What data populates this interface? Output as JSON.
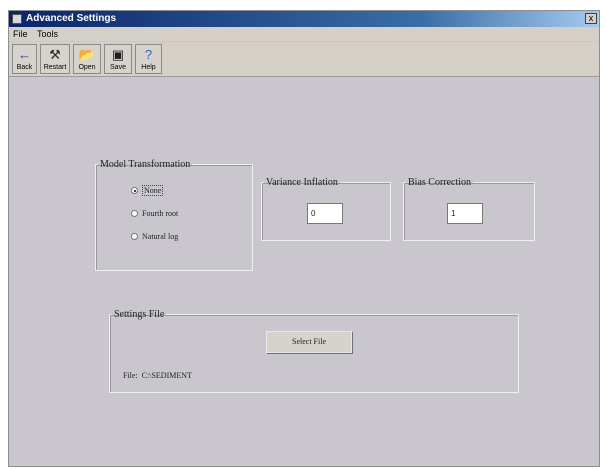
{
  "window": {
    "title": "Advanced Settings",
    "close_label": "x"
  },
  "menu": {
    "items": [
      "File",
      "Tools"
    ]
  },
  "toolbar": {
    "buttons": [
      {
        "label": "Back",
        "icon": "back-arrow-icon"
      },
      {
        "label": "Restart",
        "icon": "tools-icon"
      },
      {
        "label": "Open",
        "icon": "open-folder-icon"
      },
      {
        "label": "Save",
        "icon": "floppy-disk-icon"
      },
      {
        "label": "Help",
        "icon": "help-icon"
      }
    ]
  },
  "model_transformation": {
    "legend": "Model Transformation",
    "options": [
      "None",
      "Fourth root",
      "Natural log"
    ],
    "selected": "None"
  },
  "variance_inflation": {
    "legend": "Variance Inflation",
    "value": "0"
  },
  "bias_correction": {
    "legend": "Bias Correction",
    "value": "1"
  },
  "settings_file": {
    "legend": "Settings File",
    "select_button": "Select File",
    "file_label": "File:",
    "file_value": "C:\\SEDIMENT"
  },
  "colors": {
    "title_start": "#0a246a",
    "title_end": "#a6caf0",
    "window_bg": "#c9c7cd"
  }
}
